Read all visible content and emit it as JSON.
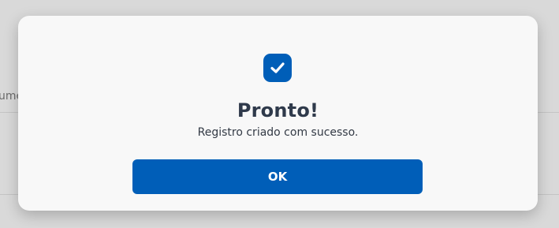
{
  "background": {
    "partial_text": "ume"
  },
  "dialog": {
    "icon": "check-icon",
    "title": "Pronto!",
    "message": "Registro criado com sucesso.",
    "ok_label": "OK"
  },
  "colors": {
    "primary": "#005eb8",
    "title_text": "#2f3a4b",
    "dialog_bg": "#f8f8f8",
    "backdrop": "#d9d9d9"
  }
}
